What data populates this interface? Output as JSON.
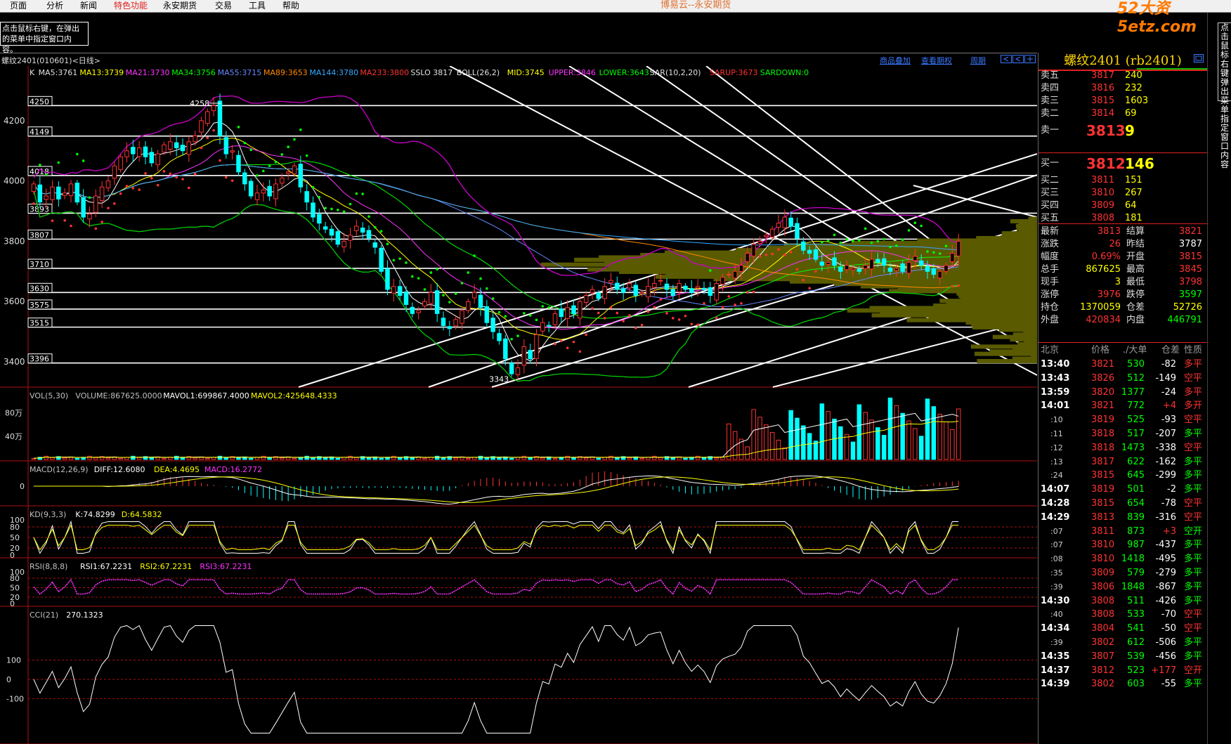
{
  "menubar": {
    "items": [
      "页面",
      "分析",
      "新闻",
      "特色功能",
      "永安期货",
      "交易",
      "工具",
      "帮助"
    ],
    "highlight_index": 3,
    "app_title": "博易云--永安期货",
    "watermark": "52大资5etz.com"
  },
  "hint_box": "点击鼠标右键，在弹出的菜单中指定窗口内容。",
  "side_tab": "点击鼠标右键弹出菜单指定窗口内容",
  "chart_header": {
    "symbol_label": "螺纹2401(010601)<日线>",
    "links": [
      "商品叠加",
      "查看期权",
      "周期"
    ]
  },
  "main_indicators": [
    {
      "text": "K",
      "color": "#e0e0e0"
    },
    {
      "text": "MA5:3761",
      "color": "#e0e0e0"
    },
    {
      "text": "MA13:3739",
      "color": "#ffff00"
    },
    {
      "text": "MA21:3730",
      "color": "#ff33ff"
    },
    {
      "text": "MA34:3756",
      "color": "#00ff00"
    },
    {
      "text": "MA55:3715",
      "color": "#6688ff"
    },
    {
      "text": "MA89:3653",
      "color": "#ff8800"
    },
    {
      "text": "MA144:3780",
      "color": "#33aaff"
    },
    {
      "text": "MA233:3800",
      "color": "#ff3333"
    },
    {
      "text": "SSLO 3817",
      "color": "#e0e0e0"
    },
    {
      "text": "BOLL(26,2)",
      "color": "#e0e0e0"
    },
    {
      "text": "MID:3745",
      "color": "#ffff00"
    },
    {
      "text": "UPPER:3846",
      "color": "#ff33ff"
    },
    {
      "text": "LOWER:3643",
      "color": "#00ff00"
    },
    {
      "text": "SAR(10,2,20)",
      "color": "#e0e0e0"
    },
    {
      "text": "SARUP:3673",
      "color": "#ff3333"
    },
    {
      "text": "SARDOWN:0",
      "color": "#00ff00"
    }
  ],
  "price_axis": {
    "ticks": [
      "4200",
      "4000",
      "3800",
      "3600",
      "3400"
    ],
    "level_boxes": [
      "4250",
      "4149",
      "4018",
      "3893",
      "3807",
      "3710",
      "3630",
      "3575",
      "3515",
      "3396"
    ],
    "high_label": "4258",
    "low_label": "3343"
  },
  "chart_data": {
    "type": "candlestick",
    "ylim": [
      3330,
      4330
    ],
    "closes": [
      3990,
      3930,
      3950,
      3980,
      3940,
      3960,
      3990,
      3930,
      3880,
      3890,
      3950,
      3980,
      4000,
      4050,
      4080,
      4100,
      4090,
      4110,
      4080,
      4060,
      4090,
      4120,
      4130,
      4110,
      4100,
      4130,
      4150,
      4200,
      4230,
      4250,
      4150,
      4090,
      4100,
      4030,
      3990,
      3950,
      3960,
      3970,
      3950,
      3990,
      4010,
      4030,
      4050,
      3980,
      3930,
      3880,
      3860,
      3840,
      3820,
      3790,
      3800,
      3820,
      3850,
      3830,
      3810,
      3780,
      3700,
      3640,
      3650,
      3620,
      3590,
      3560,
      3570,
      3600,
      3630,
      3560,
      3520,
      3510,
      3540,
      3570,
      3600,
      3630,
      3580,
      3530,
      3500,
      3470,
      3410,
      3360,
      3380,
      3450,
      3410,
      3490,
      3530,
      3520,
      3560,
      3550,
      3580,
      3560,
      3600,
      3620,
      3640,
      3610,
      3650,
      3670,
      3640,
      3630,
      3660,
      3620,
      3630,
      3650,
      3660,
      3670,
      3640,
      3620,
      3660,
      3640,
      3630,
      3650,
      3640,
      3620,
      3660,
      3680,
      3690,
      3700,
      3720,
      3760,
      3790,
      3800,
      3820,
      3840,
      3860,
      3880,
      3850,
      3810,
      3770,
      3760,
      3740,
      3720,
      3730,
      3720,
      3700,
      3720,
      3710,
      3700,
      3720,
      3740,
      3730,
      3720,
      3700,
      3710,
      3700,
      3730,
      3750,
      3720,
      3700,
      3690,
      3700,
      3720,
      3760,
      3800
    ],
    "volume": {
      "ylim": [
        0,
        1000000
      ],
      "ticks": [
        "80万",
        "40万"
      ],
      "last": 867625
    },
    "macd": {
      "ticks": [
        "0"
      ]
    },
    "kd": {
      "ticks": [
        "100",
        "80",
        "50",
        "20",
        "0"
      ]
    },
    "rsi": {
      "ticks": [
        "100",
        "80",
        "50",
        "20",
        "0"
      ]
    },
    "cci": {
      "ticks": [
        "100",
        "0",
        "-100"
      ]
    }
  },
  "sub_indicators": {
    "vol": [
      {
        "text": "VOL(5,30)",
        "color": "#c0c0c0"
      },
      {
        "text": "VOLUME:867625.0000",
        "color": "#c0c0c0"
      },
      {
        "text": "MAVOL1:699867.4000",
        "color": "#ffffff"
      },
      {
        "text": "MAVOL2:425648.4333",
        "color": "#ffff00"
      }
    ],
    "macd": [
      {
        "text": "MACD(12,26,9)",
        "color": "#c0c0c0"
      },
      {
        "text": "DIFF:12.6080",
        "color": "#ffffff"
      },
      {
        "text": "DEA:4.4695",
        "color": "#ffff00"
      },
      {
        "text": "MACD:16.2772",
        "color": "#ff33ff"
      }
    ],
    "kd": [
      {
        "text": "KD(9,3,3)",
        "color": "#c0c0c0"
      },
      {
        "text": "K:74.8299",
        "color": "#ffffff"
      },
      {
        "text": "D:64.5832",
        "color": "#ffff00"
      }
    ],
    "rsi": [
      {
        "text": "RSI(8,8,8)",
        "color": "#c0c0c0"
      },
      {
        "text": "RSI1:67.2231",
        "color": "#ffffff"
      },
      {
        "text": "RSI2:67.2231",
        "color": "#ffff00"
      },
      {
        "text": "RSI3:67.2231",
        "color": "#ff33ff"
      }
    ],
    "cci": [
      {
        "text": "CCI(21)",
        "color": "#c0c0c0"
      },
      {
        "text": "270.1323",
        "color": "#ffffff"
      }
    ]
  },
  "quote_panel": {
    "title": "螺纹2401 (rb2401)",
    "asks": [
      {
        "label": "卖五",
        "price": "3817",
        "vol": "240"
      },
      {
        "label": "卖四",
        "price": "3816",
        "vol": "232"
      },
      {
        "label": "卖三",
        "price": "3815",
        "vol": "1603"
      },
      {
        "label": "卖二",
        "price": "3814",
        "vol": "69"
      },
      {
        "label": "卖一",
        "price": "3813",
        "vol": "9"
      }
    ],
    "bids": [
      {
        "label": "买一",
        "price": "3812",
        "vol": "146"
      },
      {
        "label": "买二",
        "price": "3811",
        "vol": "151"
      },
      {
        "label": "买三",
        "price": "3810",
        "vol": "267"
      },
      {
        "label": "买四",
        "price": "3809",
        "vol": "64"
      },
      {
        "label": "买五",
        "price": "3808",
        "vol": "181"
      }
    ],
    "stats": [
      {
        "l1": "最新",
        "v1": "3813",
        "c1": "#ff3333",
        "l2": "结算",
        "v2": "3821",
        "c2": "#ff3333"
      },
      {
        "l1": "涨跌",
        "v1": "26",
        "c1": "#ff3333",
        "l2": "昨结",
        "v2": "3787",
        "c2": "#ffffff"
      },
      {
        "l1": "幅度",
        "v1": "0.69%",
        "c1": "#ff3333",
        "l2": "开盘",
        "v2": "3815",
        "c2": "#ff3333"
      },
      {
        "l1": "总手",
        "v1": "867625",
        "c1": "#ffff00",
        "l2": "最高",
        "v2": "3845",
        "c2": "#ff3333"
      },
      {
        "l1": "现手",
        "v1": "3",
        "c1": "#ffff00",
        "l2": "最低",
        "v2": "3798",
        "c2": "#ff3333"
      },
      {
        "l1": "涨停",
        "v1": "3976",
        "c1": "#ff3333",
        "l2": "跌停",
        "v2": "3597",
        "c2": "#00ff00"
      },
      {
        "l1": "持仓",
        "v1": "1370059",
        "c1": "#ffff00",
        "l2": "仓差",
        "v2": "52726",
        "c2": "#ffff00"
      },
      {
        "l1": "外盘",
        "v1": "420834",
        "c1": "#ff3333",
        "l2": "内盘",
        "v2": "446791",
        "c2": "#00ff00"
      }
    ],
    "tick_header": [
      "北京",
      "价格",
      "./大单",
      "仓差",
      "性质"
    ],
    "ticks": [
      {
        "time": "13:40",
        "price": "3821",
        "vol": "530",
        "diff": "-82",
        "kind": "多平",
        "kc": "#ff3333"
      },
      {
        "time": "13:43",
        "price": "3826",
        "vol": "512",
        "diff": "-149",
        "kind": "空平",
        "kc": "#ff3333"
      },
      {
        "time": "13:59",
        "price": "3820",
        "vol": "1377",
        "diff": "-24",
        "kind": "多平",
        "kc": "#ff3333"
      },
      {
        "time": "14:01",
        "price": "3821",
        "vol": "772",
        "diff": "+4",
        "kind": "多开",
        "kc": "#ff3333"
      },
      {
        "time": ":10",
        "price": "3819",
        "vol": "525",
        "diff": "-93",
        "kind": "空平",
        "kc": "#ff3333"
      },
      {
        "time": ":11",
        "price": "3818",
        "vol": "517",
        "diff": "-207",
        "kind": "多平",
        "kc": "#00ff00"
      },
      {
        "time": ":12",
        "price": "3818",
        "vol": "1473",
        "diff": "-338",
        "kind": "空平",
        "kc": "#ff3333"
      },
      {
        "time": ":13",
        "price": "3817",
        "vol": "622",
        "diff": "-162",
        "kind": "多平",
        "kc": "#00ff00"
      },
      {
        "time": ":24",
        "price": "3815",
        "vol": "645",
        "diff": "-299",
        "kind": "多平",
        "kc": "#00ff00"
      },
      {
        "time": "14:07",
        "price": "3819",
        "vol": "501",
        "diff": "-2",
        "kind": "多平",
        "kc": "#00ff00"
      },
      {
        "time": "14:28",
        "price": "3815",
        "vol": "654",
        "diff": "-78",
        "kind": "空平",
        "kc": "#ff3333"
      },
      {
        "time": "14:29",
        "price": "3813",
        "vol": "839",
        "diff": "-316",
        "kind": "空平",
        "kc": "#ff3333"
      },
      {
        "time": ":07",
        "price": "3811",
        "vol": "873",
        "diff": "+3",
        "kind": "空开",
        "kc": "#00ff00"
      },
      {
        "time": ":07",
        "price": "3810",
        "vol": "987",
        "diff": "-437",
        "kind": "多平",
        "kc": "#00ff00"
      },
      {
        "time": ":08",
        "price": "3810",
        "vol": "1418",
        "diff": "-495",
        "kind": "多平",
        "kc": "#00ff00"
      },
      {
        "time": ":35",
        "price": "3809",
        "vol": "579",
        "diff": "-279",
        "kind": "多平",
        "kc": "#00ff00"
      },
      {
        "time": ":39",
        "price": "3806",
        "vol": "1848",
        "diff": "-867",
        "kind": "多平",
        "kc": "#00ff00"
      },
      {
        "time": "14:30",
        "price": "3808",
        "vol": "511",
        "diff": "-426",
        "kind": "多平",
        "kc": "#00ff00"
      },
      {
        "time": ":40",
        "price": "3808",
        "vol": "533",
        "diff": "-70",
        "kind": "空平",
        "kc": "#ff3333"
      },
      {
        "time": "14:34",
        "price": "3804",
        "vol": "541",
        "diff": "-50",
        "kind": "空平",
        "kc": "#ff3333"
      },
      {
        "time": ":39",
        "price": "3802",
        "vol": "612",
        "diff": "-506",
        "kind": "多平",
        "kc": "#00ff00"
      },
      {
        "time": "14:35",
        "price": "3807",
        "vol": "539",
        "diff": "-456",
        "kind": "多平",
        "kc": "#00ff00"
      },
      {
        "time": "14:37",
        "price": "3812",
        "vol": "523",
        "diff": "+177",
        "kind": "空开",
        "kc": "#ff3333"
      },
      {
        "time": "14:39",
        "price": "3802",
        "vol": "603",
        "diff": "-55",
        "kind": "多平",
        "kc": "#00ff00"
      }
    ]
  }
}
